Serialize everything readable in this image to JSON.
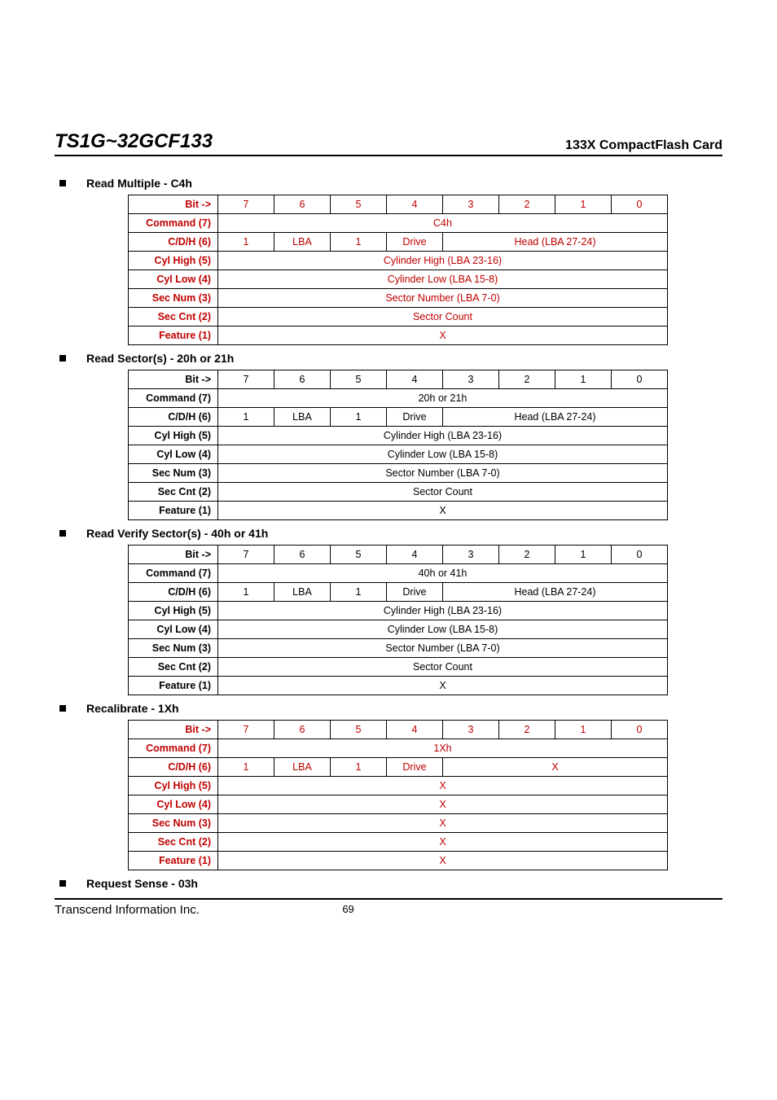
{
  "header": {
    "product": "TS1G~32GCF133",
    "subtitle": "133X CompactFlash Card"
  },
  "bits": [
    "7",
    "6",
    "5",
    "4",
    "3",
    "2",
    "1",
    "0"
  ],
  "row_labels": {
    "bit": "Bit ->",
    "command": "Command (7)",
    "cdh": "C/D/H (6)",
    "cyl_high": "Cyl High (5)",
    "cyl_low": "Cyl Low (4)",
    "sec_num": "Sec Num (3)",
    "sec_cnt": "Sec Cnt (2)",
    "feature": "Feature (1)"
  },
  "cdh_cells": {
    "b7": "1",
    "lba": "LBA",
    "b5": "1",
    "drive": "Drive",
    "head": "Head (LBA 27-24)",
    "x": "X"
  },
  "span_rows": {
    "cyl_high": "Cylinder High (LBA 23-16)",
    "cyl_low": "Cylinder Low (LBA 15-8)",
    "sec_num": "Sector Number (LBA 7-0)",
    "sec_cnt": "Sector Count",
    "feature_x": "X"
  },
  "sections": [
    {
      "title": "Read Multiple - C4h",
      "command": "C4h",
      "color": "red",
      "cdh_tail": "head",
      "spans": [
        "cyl_high",
        "cyl_low",
        "sec_num",
        "sec_cnt",
        "feature_x"
      ]
    },
    {
      "title": "Read Sector(s) - 20h or 21h",
      "command": "20h or 21h",
      "color": "black",
      "cdh_tail": "head",
      "spans": [
        "cyl_high",
        "cyl_low",
        "sec_num",
        "sec_cnt",
        "feature_x"
      ]
    },
    {
      "title": "Read Verify Sector(s) - 40h or 41h",
      "command": "40h or 41h",
      "color": "black",
      "cdh_tail": "head",
      "spans": [
        "cyl_high",
        "cyl_low",
        "sec_num",
        "sec_cnt",
        "feature_x"
      ]
    },
    {
      "title": "Recalibrate - 1Xh",
      "command": "1Xh",
      "color": "red",
      "cdh_tail": "x",
      "spans": [
        "feature_x",
        "feature_x",
        "feature_x",
        "feature_x",
        "feature_x"
      ]
    },
    {
      "title": "Request Sense - 03h",
      "command": "",
      "color": "black",
      "notable": true
    }
  ],
  "footer": {
    "company": "Transcend Information Inc.",
    "page": "69"
  }
}
